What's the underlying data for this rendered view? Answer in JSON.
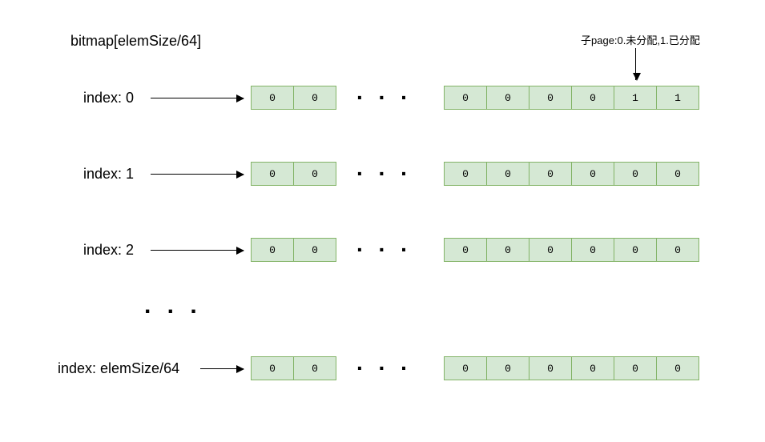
{
  "title": "bitmap[elemSize/64]",
  "note": "子page:0.未分配,1.已分配",
  "ellipsis": ". . .",
  "rows": [
    {
      "label": "index: 0",
      "left_cells": [
        "0",
        "0"
      ],
      "right_cells": [
        "0",
        "0",
        "0",
        "0",
        "1",
        "1"
      ]
    },
    {
      "label": "index: 1",
      "left_cells": [
        "0",
        "0"
      ],
      "right_cells": [
        "0",
        "0",
        "0",
        "0",
        "0",
        "0"
      ]
    },
    {
      "label": "index: 2",
      "left_cells": [
        "0",
        "0"
      ],
      "right_cells": [
        "0",
        "0",
        "0",
        "0",
        "0",
        "0"
      ]
    },
    {
      "label": "index: elemSize/64",
      "left_cells": [
        "0",
        "0"
      ],
      "right_cells": [
        "0",
        "0",
        "0",
        "0",
        "0",
        "0"
      ]
    }
  ],
  "vertical_ellipsis": ". . ."
}
